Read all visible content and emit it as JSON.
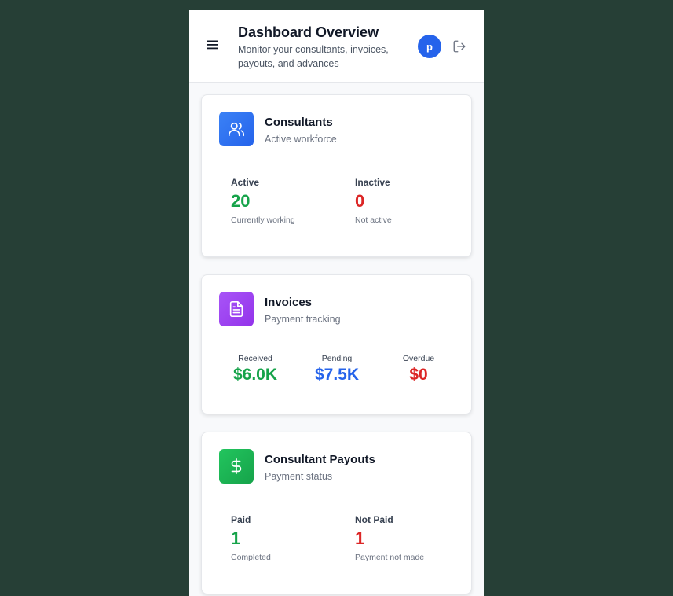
{
  "header": {
    "title": "Dashboard Overview",
    "subtitle": "Monitor your consultants, invoices, payouts, and advances",
    "avatar_initial": "p",
    "menu_icon": "menu-icon",
    "logout_icon": "logout-icon"
  },
  "colors": {
    "background": "#263f36",
    "green": "#16a34a",
    "red": "#dc2626",
    "blue": "#2563eb"
  },
  "consultants": {
    "title": "Consultants",
    "subtitle": "Active workforce",
    "icon": "users-icon",
    "active": {
      "label": "Active",
      "value": "20",
      "note": "Currently working"
    },
    "inactive": {
      "label": "Inactive",
      "value": "0",
      "note": "Not active"
    }
  },
  "invoices": {
    "title": "Invoices",
    "subtitle": "Payment tracking",
    "icon": "document-icon",
    "received": {
      "label": "Received",
      "value": "$6.0K"
    },
    "pending": {
      "label": "Pending",
      "value": "$7.5K"
    },
    "overdue": {
      "label": "Overdue",
      "value": "$0"
    }
  },
  "payouts": {
    "title": "Consultant Payouts",
    "subtitle": "Payment status",
    "icon": "dollar-icon",
    "paid": {
      "label": "Paid",
      "value": "1",
      "note": "Completed"
    },
    "not_paid": {
      "label": "Not Paid",
      "value": "1",
      "note": "Payment not made"
    }
  }
}
